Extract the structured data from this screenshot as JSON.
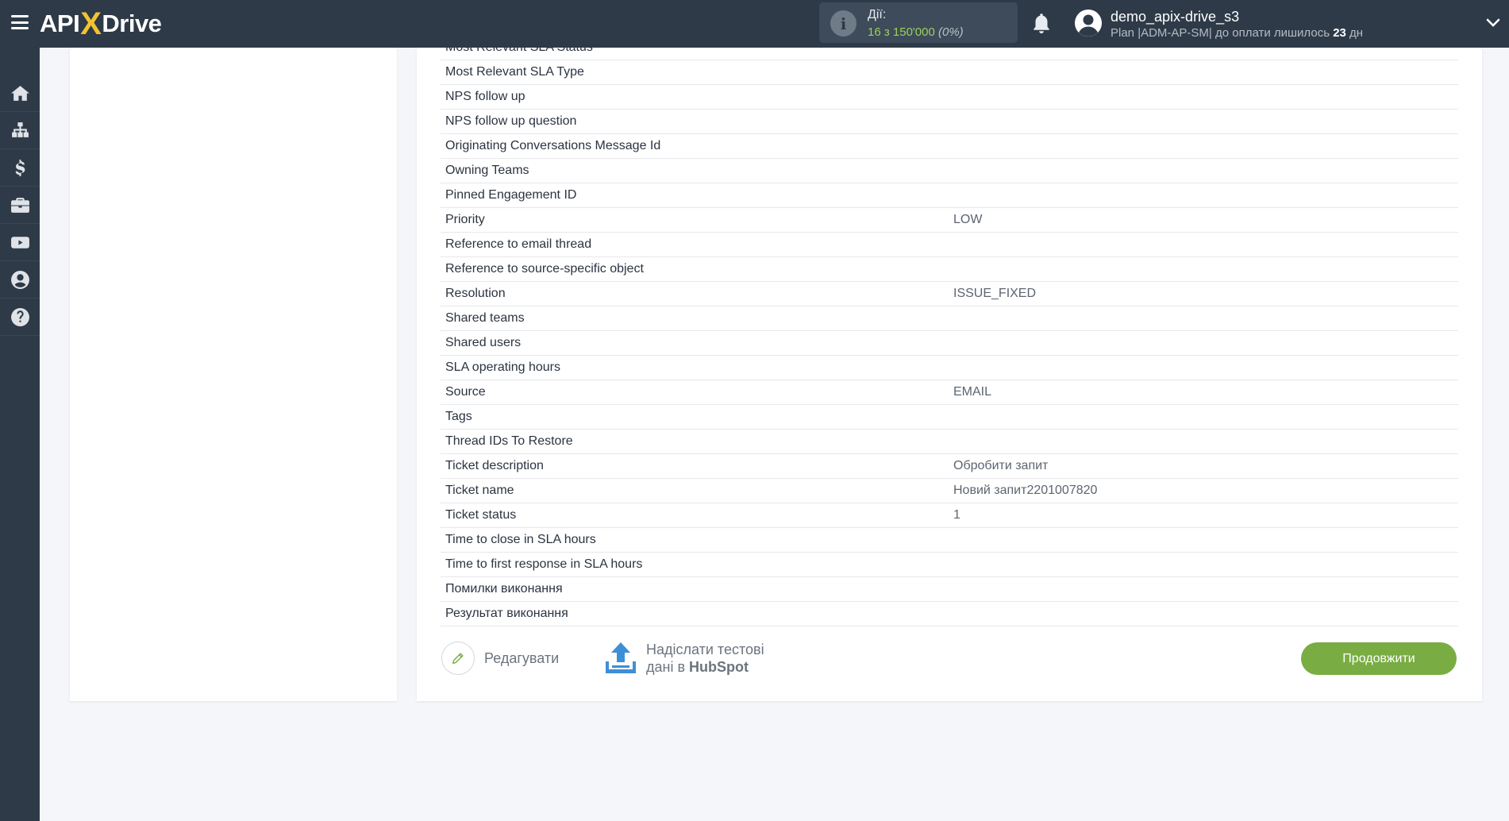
{
  "header": {
    "logo_left": "API",
    "logo_x": "X",
    "logo_right": "Drive",
    "actions_label": "Дії:",
    "actions_value": "16 з 150'000",
    "actions_percent": "(0%)",
    "user_name": "demo_apix-drive_s3",
    "plan_prefix": "Plan |ADM-AP-SM| до оплати лишилось",
    "plan_days": "23",
    "plan_suffix": "дн"
  },
  "sidebar": {
    "items": [
      {
        "icon": "home-icon"
      },
      {
        "icon": "sitemap-icon"
      },
      {
        "icon": "dollar-icon"
      },
      {
        "icon": "briefcase-icon"
      },
      {
        "icon": "youtube-icon"
      },
      {
        "icon": "user-circle-icon"
      },
      {
        "icon": "question-icon"
      }
    ]
  },
  "fields": [
    {
      "name": "Most Relevant SLA Status",
      "value": ""
    },
    {
      "name": "Most Relevant SLA Type",
      "value": ""
    },
    {
      "name": "NPS follow up",
      "value": ""
    },
    {
      "name": "NPS follow up question",
      "value": ""
    },
    {
      "name": "Originating Conversations Message Id",
      "value": ""
    },
    {
      "name": "Owning Teams",
      "value": ""
    },
    {
      "name": "Pinned Engagement ID",
      "value": ""
    },
    {
      "name": "Priority",
      "value": "LOW"
    },
    {
      "name": "Reference to email thread",
      "value": ""
    },
    {
      "name": "Reference to source-specific object",
      "value": ""
    },
    {
      "name": "Resolution",
      "value": "ISSUE_FIXED"
    },
    {
      "name": "Shared teams",
      "value": ""
    },
    {
      "name": "Shared users",
      "value": ""
    },
    {
      "name": "SLA operating hours",
      "value": ""
    },
    {
      "name": "Source",
      "value": "EMAIL"
    },
    {
      "name": "Tags",
      "value": ""
    },
    {
      "name": "Thread IDs To Restore",
      "value": ""
    },
    {
      "name": "Ticket description",
      "value": "Обробити запит"
    },
    {
      "name": "Ticket name",
      "value": "Новий запит2201007820"
    },
    {
      "name": "Ticket status",
      "value": "1"
    },
    {
      "name": "Time to close in SLA hours",
      "value": ""
    },
    {
      "name": "Time to first response in SLA hours",
      "value": ""
    },
    {
      "name": "Помилки виконання",
      "value": ""
    },
    {
      "name": "Результат виконання",
      "value": ""
    }
  ],
  "buttons": {
    "edit_label": "Редагувати",
    "send_line1": "Надіслати тестові",
    "send_line2_prefix": "дані в",
    "send_line2_brand": "HubSpot",
    "continue_label": "Продовжити"
  },
  "colors": {
    "topbar": "#2e3a47",
    "accent_green": "#79ad43",
    "upload_blue": "#3d8fd6"
  }
}
